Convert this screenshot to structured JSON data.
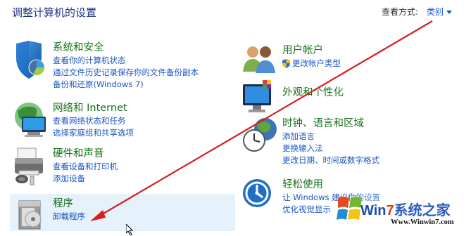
{
  "header": {
    "title": "调整计算机的设置",
    "view_by_label": "查看方式:",
    "view_by_value": "类别"
  },
  "categories": {
    "system": {
      "title": "系统和安全",
      "links": [
        "查看你的计算机状态",
        "通过文件历史记录保存你的文件备份副本",
        "备份和还原(Windows 7)"
      ]
    },
    "network": {
      "title": "网络和 Internet",
      "links": [
        "查看网络状态和任务",
        "选择家庭组和共享选项"
      ]
    },
    "hardware": {
      "title": "硬件和声音",
      "links": [
        "查看设备和打印机",
        "添加设备"
      ]
    },
    "programs": {
      "title": "程序",
      "links": [
        "卸载程序"
      ]
    },
    "accounts": {
      "title": "用户帐户",
      "links": [
        "更改帐户类型"
      ]
    },
    "appearance": {
      "title": "外观和个性化",
      "links": []
    },
    "clock": {
      "title": "时钟、语言和区域",
      "links": [
        "添加语言",
        "更换输入法",
        "更改日期、时间或数字格式"
      ]
    },
    "ease": {
      "title": "轻松使用",
      "links": [
        "让 Windows 建议你的设置",
        "优化视觉显示"
      ]
    }
  },
  "watermark": {
    "brand_prefix": "Win",
    "brand_seven": "7",
    "brand_suffix": "系统之家",
    "site": "Www.Winwin7.com"
  },
  "colors": {
    "title": "#1e3287",
    "category_title": "#17701a",
    "link": "#1a56c4",
    "arrow": "#d42020",
    "selection": "#e5f1fb"
  }
}
